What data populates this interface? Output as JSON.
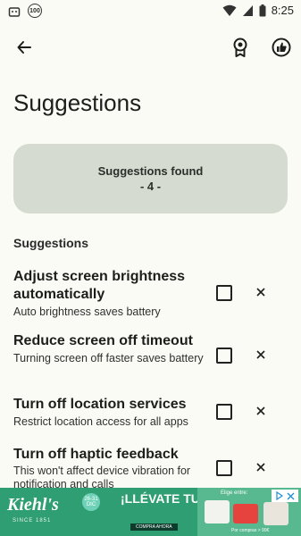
{
  "status_bar": {
    "time": "8:25",
    "badge": "100",
    "icons": [
      "gift-icon",
      "badge-icon",
      "wifi-icon",
      "signal-icon",
      "battery-icon"
    ]
  },
  "app_bar": {
    "icons": [
      "back-arrow-icon",
      "award-icon",
      "thumbs-up-icon"
    ]
  },
  "page": {
    "title": "Suggestions"
  },
  "summary": {
    "title": "Suggestions found",
    "count": "- 4 -"
  },
  "section": {
    "label": "Suggestions"
  },
  "suggestions": [
    {
      "title": "Adjust screen brightness automatically",
      "subtitle": "Auto brightness saves battery"
    },
    {
      "title": "Reduce screen off timeout",
      "subtitle": "Turning screen off faster saves battery"
    },
    {
      "title": "Turn off location services",
      "subtitle": "Restrict location access for all apps"
    },
    {
      "title": "Turn off haptic feedback",
      "subtitle": "This won't affect device vibration for notification and calls"
    }
  ],
  "ad": {
    "brand": "Kiehl's",
    "brand_sub": "SINCE 1851",
    "sticker": "26-31 DIC",
    "headline": "¡LLÉVATE TU REGALO!",
    "cta": "COMPRA AHORA",
    "right_top": "Elige entre:",
    "right_bottom": "Por compras > 99€"
  },
  "colors": {
    "background": "#fbfbf6",
    "card": "#d5dbd0",
    "ad_green": "#2f9e72"
  }
}
